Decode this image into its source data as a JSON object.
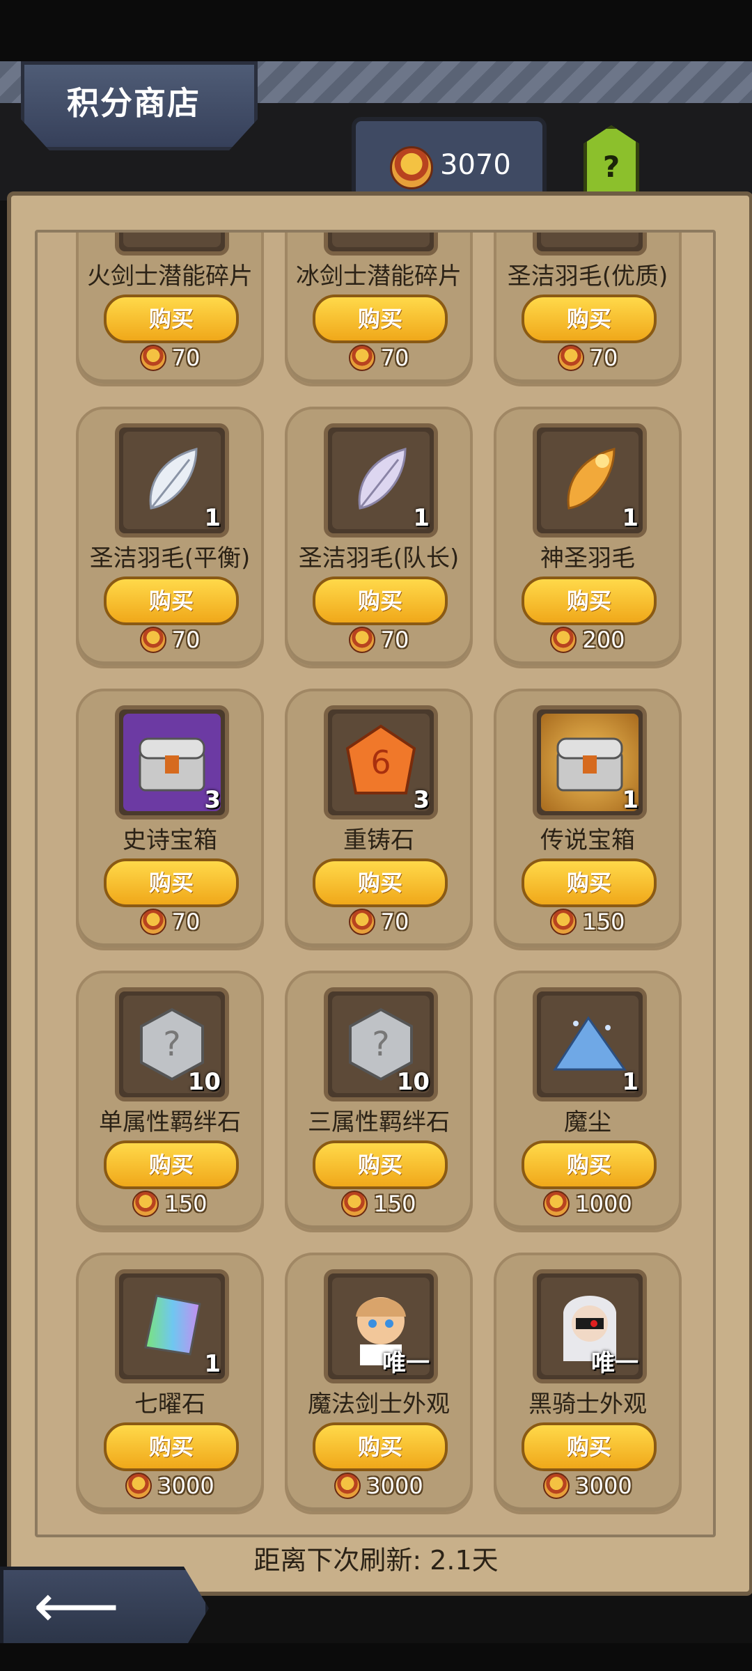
{
  "header": {
    "title": "积分商店",
    "points": "3070",
    "help_label": "?"
  },
  "refresh_text": "距离下次刷新: 2.1天",
  "buy_label": "购买",
  "items": [
    {
      "name": "火剑士潜能碎片",
      "qty": "",
      "price": "70",
      "icon": "partial-item",
      "bg": "plain"
    },
    {
      "name": "冰剑士潜能碎片",
      "qty": "",
      "price": "70",
      "icon": "partial-item",
      "bg": "plain"
    },
    {
      "name": "圣洁羽毛(优质)",
      "qty": "",
      "price": "70",
      "icon": "partial-item",
      "bg": "plain"
    },
    {
      "name": "圣洁羽毛(平衡)",
      "qty": "1",
      "price": "70",
      "icon": "white-feather-icon",
      "bg": "plain"
    },
    {
      "name": "圣洁羽毛(队长)",
      "qty": "1",
      "price": "70",
      "icon": "lavender-feather-icon",
      "bg": "plain"
    },
    {
      "name": "神圣羽毛",
      "qty": "1",
      "price": "200",
      "icon": "golden-feather-icon",
      "bg": "plain"
    },
    {
      "name": "史诗宝箱",
      "qty": "3",
      "price": "70",
      "icon": "epic-chest-icon",
      "bg": "purple"
    },
    {
      "name": "重铸石",
      "qty": "3",
      "price": "70",
      "icon": "reforge-stone-icon",
      "bg": "plain"
    },
    {
      "name": "传说宝箱",
      "qty": "1",
      "price": "150",
      "icon": "legend-chest-icon",
      "bg": "gold"
    },
    {
      "name": "单属性羁绊石",
      "qty": "10",
      "price": "150",
      "icon": "mystery-stone-icon",
      "bg": "plain"
    },
    {
      "name": "三属性羁绊石",
      "qty": "10",
      "price": "150",
      "icon": "mystery-stone-icon",
      "bg": "plain"
    },
    {
      "name": "魔尘",
      "qty": "1",
      "price": "1000",
      "icon": "magic-dust-icon",
      "bg": "plain"
    },
    {
      "name": "七曜石",
      "qty": "1",
      "price": "3000",
      "icon": "rainbow-crystal-icon",
      "bg": "plain"
    },
    {
      "name": "魔法剑士外观",
      "qty": "唯一",
      "price": "3000",
      "icon": "magic-swordsman-portrait-icon",
      "bg": "plain"
    },
    {
      "name": "黑骑士外观",
      "qty": "唯一",
      "price": "3000",
      "icon": "black-knight-portrait-icon",
      "bg": "plain"
    }
  ],
  "colors": {
    "panel": "#c8b08a",
    "card": "#b59d77",
    "buy": "#ffd94a",
    "header": "#3f4a63"
  }
}
